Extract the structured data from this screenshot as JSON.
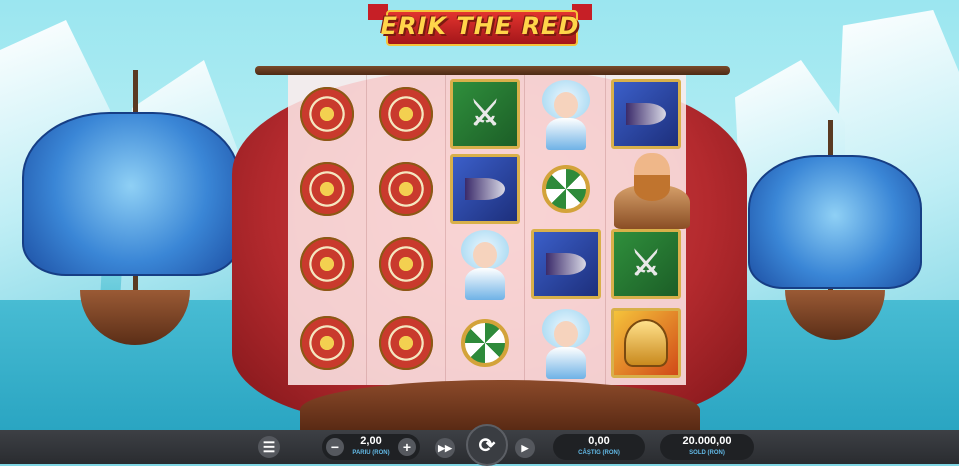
{
  "game": {
    "logo_text": "ERIK THE RED"
  },
  "grid": {
    "reels": [
      [
        "red-shield",
        "red-shield",
        "red-shield",
        "red-shield"
      ],
      [
        "red-shield",
        "red-shield",
        "red-shield",
        "red-shield"
      ],
      [
        "axe-green",
        "horn-blue",
        "ice-maiden",
        "green-shield"
      ],
      [
        "ice-maiden",
        "green-shield",
        "horn-blue",
        "ice-maiden"
      ],
      [
        "horn-blue",
        "erik",
        "axe-green",
        "helmet-gold"
      ]
    ]
  },
  "controls": {
    "menu_icon": "menu-icon",
    "bet_value": "2,00",
    "bet_label": "PARIU (RON)",
    "minus": "−",
    "plus": "+",
    "turbo_icon": "fast-forward-icon",
    "spin_icon": "spin-icon",
    "autoplay_icon": "play-icon",
    "win_value": "0,00",
    "win_label": "CÂȘTIG (RON)",
    "balance_value": "20.000,00",
    "balance_label": "SOLD (RON)"
  },
  "colors": {
    "sail": "#b42a2e",
    "bar": "#2a2c30",
    "label": "#62b9e6"
  }
}
